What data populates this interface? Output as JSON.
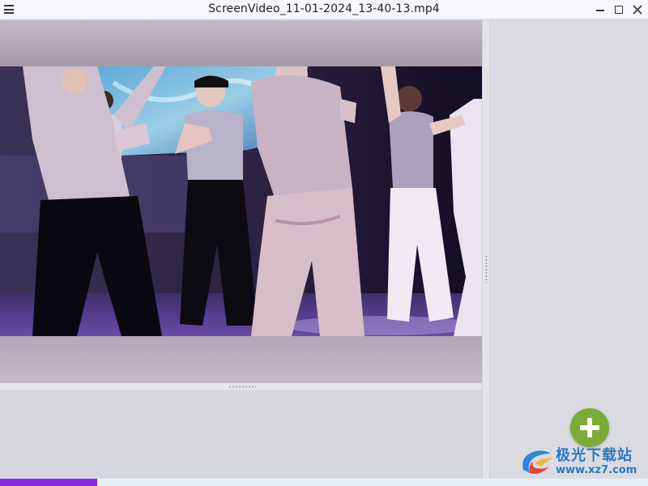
{
  "window": {
    "title": "ScreenVideo_11-01-2024_13-40-13.mp4",
    "menu_icon": "hamburger-menu-icon",
    "controls": [
      "minimize-icon",
      "maximize-icon",
      "close-icon"
    ]
  },
  "player": {
    "content": "video-frame-dancers"
  },
  "actions": {
    "add_icon": "plus-icon",
    "add_color": "#7bab36"
  },
  "watermark": {
    "brand": "极光下载站",
    "url": "www.xz7.com"
  },
  "progress": {
    "fraction": 0.15,
    "color": "#8a2be2"
  }
}
